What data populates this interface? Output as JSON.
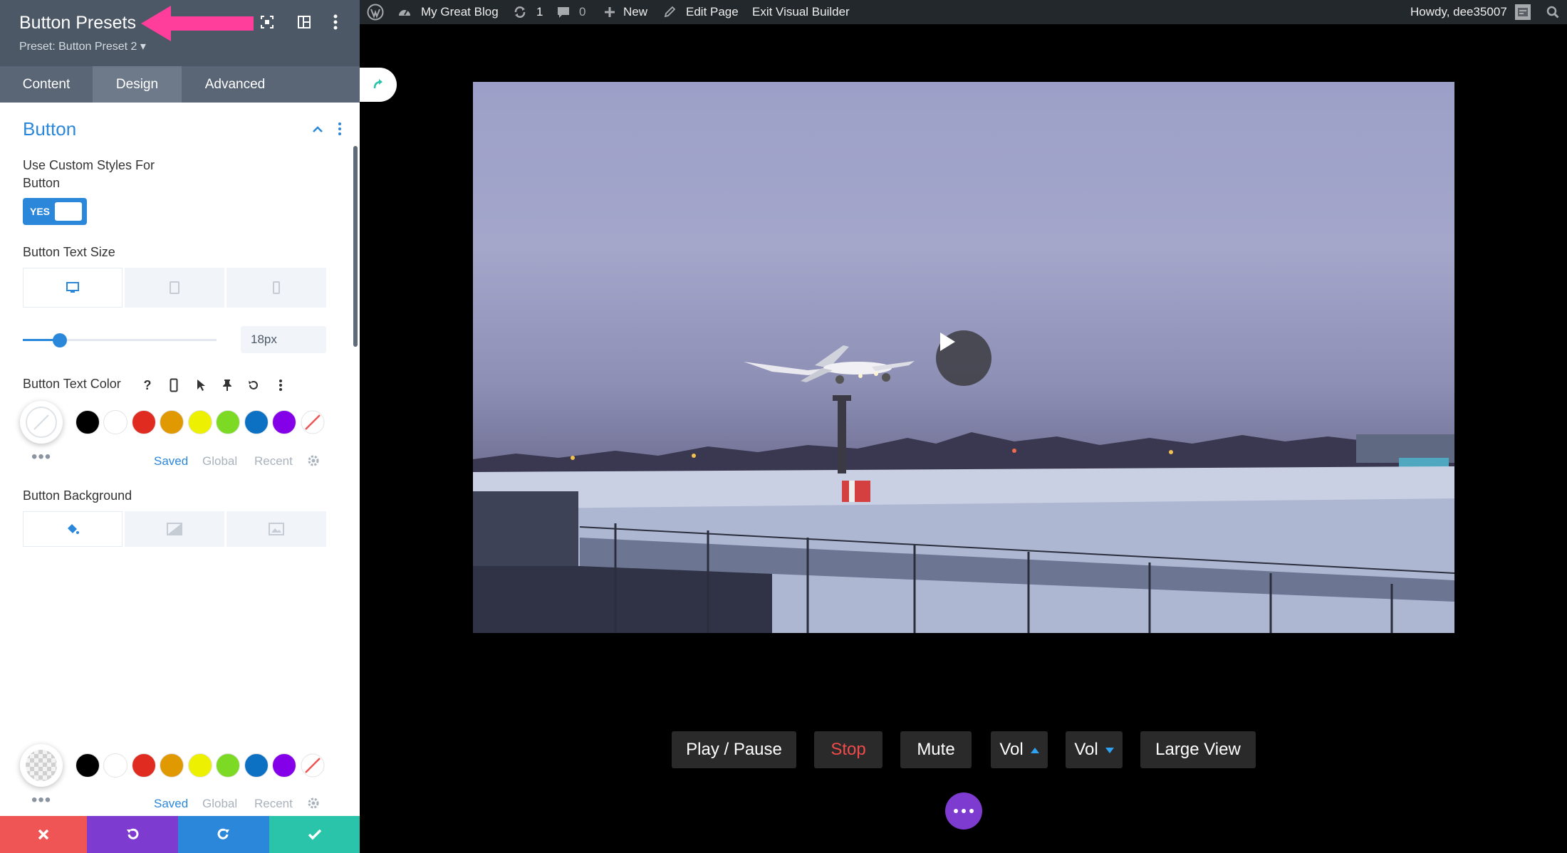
{
  "panel": {
    "title": "Button Presets",
    "preset_label": "Preset: Button Preset 2 ▾",
    "tabs": [
      "Content",
      "Design",
      "Advanced"
    ],
    "active_tab": "Design",
    "section_title": "Button",
    "custom_styles_label_line1": "Use Custom Styles For",
    "custom_styles_label_line2": "Button",
    "toggle_value": "YES",
    "text_size_label": "Button Text Size",
    "text_size_value": "18px",
    "text_size_fraction": 0.2,
    "text_color_label": "Button Text Color",
    "text_color_help": "?",
    "background_label": "Button Background",
    "palette_tabs": [
      "Saved",
      "Global",
      "Recent"
    ],
    "palette_colors": [
      "#000000",
      "#ffffff",
      "#e02b20",
      "#e09900",
      "#edf000",
      "#7cda24",
      "#0c71c3",
      "#8300e9"
    ],
    "more_dots": "•••"
  },
  "adminbar": {
    "site_name": "My Great Blog",
    "updates_count": "1",
    "comments_count": "0",
    "new_label": "New",
    "edit_page_label": "Edit Page",
    "exit_label": "Exit Visual Builder",
    "howdy": "Howdy, dee35007"
  },
  "player": {
    "buttons": {
      "play_pause": "Play / Pause",
      "stop": "Stop",
      "mute": "Mute",
      "vol_up": "Vol",
      "vol_down": "Vol",
      "large_view": "Large View"
    }
  },
  "colors": {
    "accent": "#2b87da",
    "annotation_arrow": "#ff3d9a",
    "cancel": "#ef5555",
    "undo": "#7e3bd0",
    "redo": "#2b87da",
    "save": "#29c4a9",
    "stop_text": "#ef4b4b"
  }
}
